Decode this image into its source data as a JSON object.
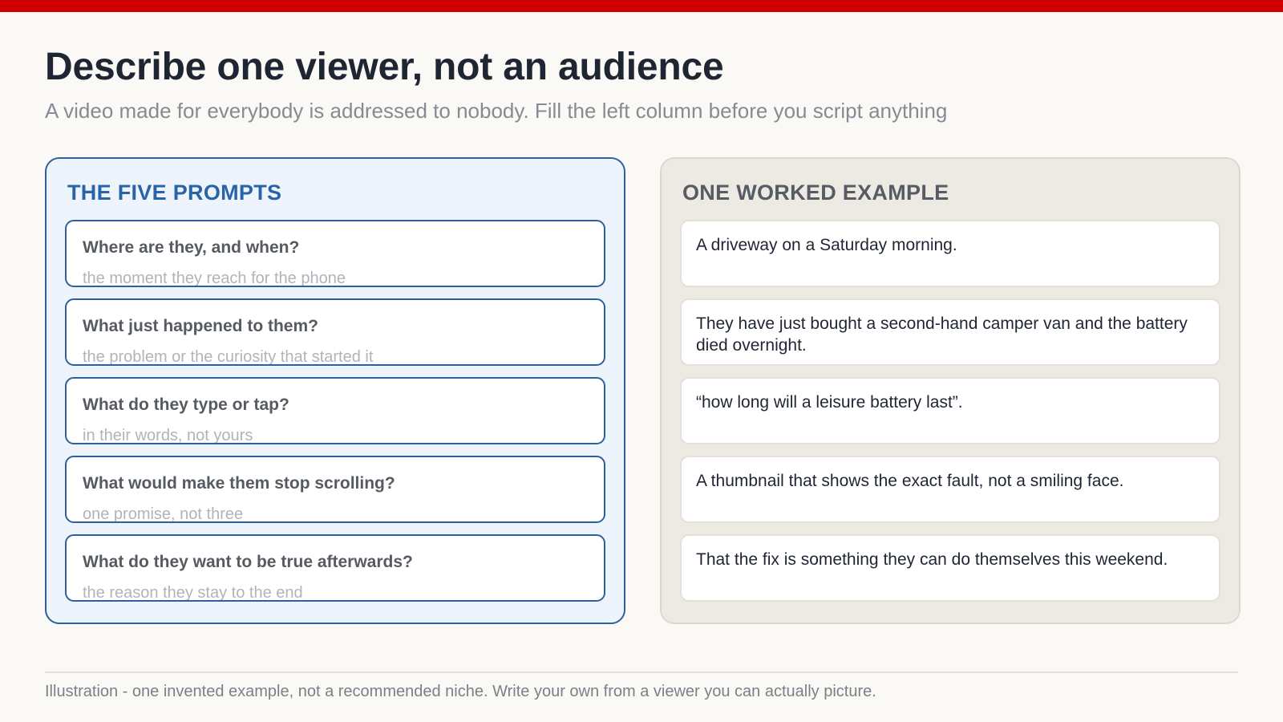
{
  "header": {
    "title": "Describe one viewer, not an audience",
    "subtitle": "A video made for everybody is addressed to nobody. Fill the left column before you script anything"
  },
  "prompts_panel": {
    "heading": "THE FIVE PROMPTS",
    "items": [
      {
        "question": "Where are they, and when?",
        "hint": "the moment they reach for the phone"
      },
      {
        "question": "What just happened to them?",
        "hint": "the problem or the curiosity that started it"
      },
      {
        "question": "What do they type or tap?",
        "hint": "in their words, not yours"
      },
      {
        "question": "What would make them stop scrolling?",
        "hint": "one promise, not three"
      },
      {
        "question": "What do they want to be true afterwards?",
        "hint": "the reason they stay to the end"
      }
    ]
  },
  "example_panel": {
    "heading": "ONE WORKED EXAMPLE",
    "items": [
      "A driveway on a Saturday morning.",
      "They have just bought a second-hand camper van and the battery died overnight.",
      "“how long will a leisure battery last”.",
      "A thumbnail that shows the exact fault, not a smiling face.",
      "That the fix is something they can do themselves this weekend."
    ]
  },
  "footer": {
    "note": "Illustration - one invented example, not a recommended niche. Write your own from a viewer you can actually picture."
  },
  "colors": {
    "accent_red": "#d10000",
    "prompt_blue": "#2f6199",
    "background": "#faf9f6"
  }
}
